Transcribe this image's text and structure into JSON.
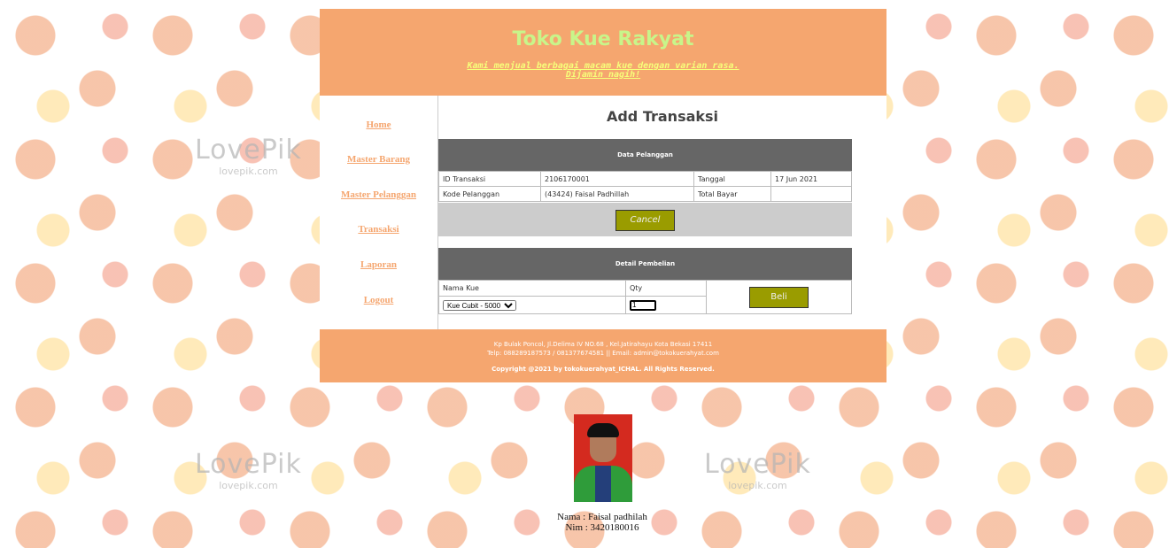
{
  "header": {
    "title": "Toko Kue Rakyat",
    "tagline_line1": "Kami menjual berbagai macam kue dengan varian rasa.",
    "tagline_line2": "Dijamin nagih!"
  },
  "nav": [
    "Home",
    "Master Barang",
    "Master Pelanggan",
    "Transaksi",
    "Laporan",
    "Logout"
  ],
  "page_title": "Add Transaksi",
  "customer_section": {
    "heading": "Data Pelanggan",
    "id_label": "ID Transaksi",
    "id_value": "2106170001",
    "date_label": "Tanggal",
    "date_value": "17 Jun 2021",
    "customer_label": "Kode Pelanggan",
    "customer_value": "(43424)  Faisal Padhillah",
    "total_label": "Total Bayar",
    "total_value": "",
    "cancel_label": "Cancel"
  },
  "purchase_section": {
    "heading": "Detail Pembelian",
    "item_label": "Nama Kue",
    "qty_label": "Qty",
    "selected_item": "Kue Cubit - 5000",
    "qty_value": "1",
    "buy_label": "Beli"
  },
  "footer": {
    "address": "Kp Bulak Poncol, Jl.Delima IV NO.68 , Kel.Jatirahayu Kota Bekasi 17411",
    "contact": "Telp: 088289187573 / 081377674581 || Email: admin@tokokuerahyat.com",
    "copyright": "Copyright @2021 by tokokuerahyat_ICHAL. All Rights Reserved."
  },
  "profile": {
    "name": "Nama : Faisal padhilah",
    "nim": "Nim : 3420180016"
  },
  "watermark": {
    "brand": "LovePik",
    "site": "lovepik.com"
  },
  "colors": {
    "accent": "#f5a66f",
    "title": "#c8f58a",
    "tagline": "#f7ff7a",
    "section_header": "#666666",
    "button": "#9a9c00"
  }
}
